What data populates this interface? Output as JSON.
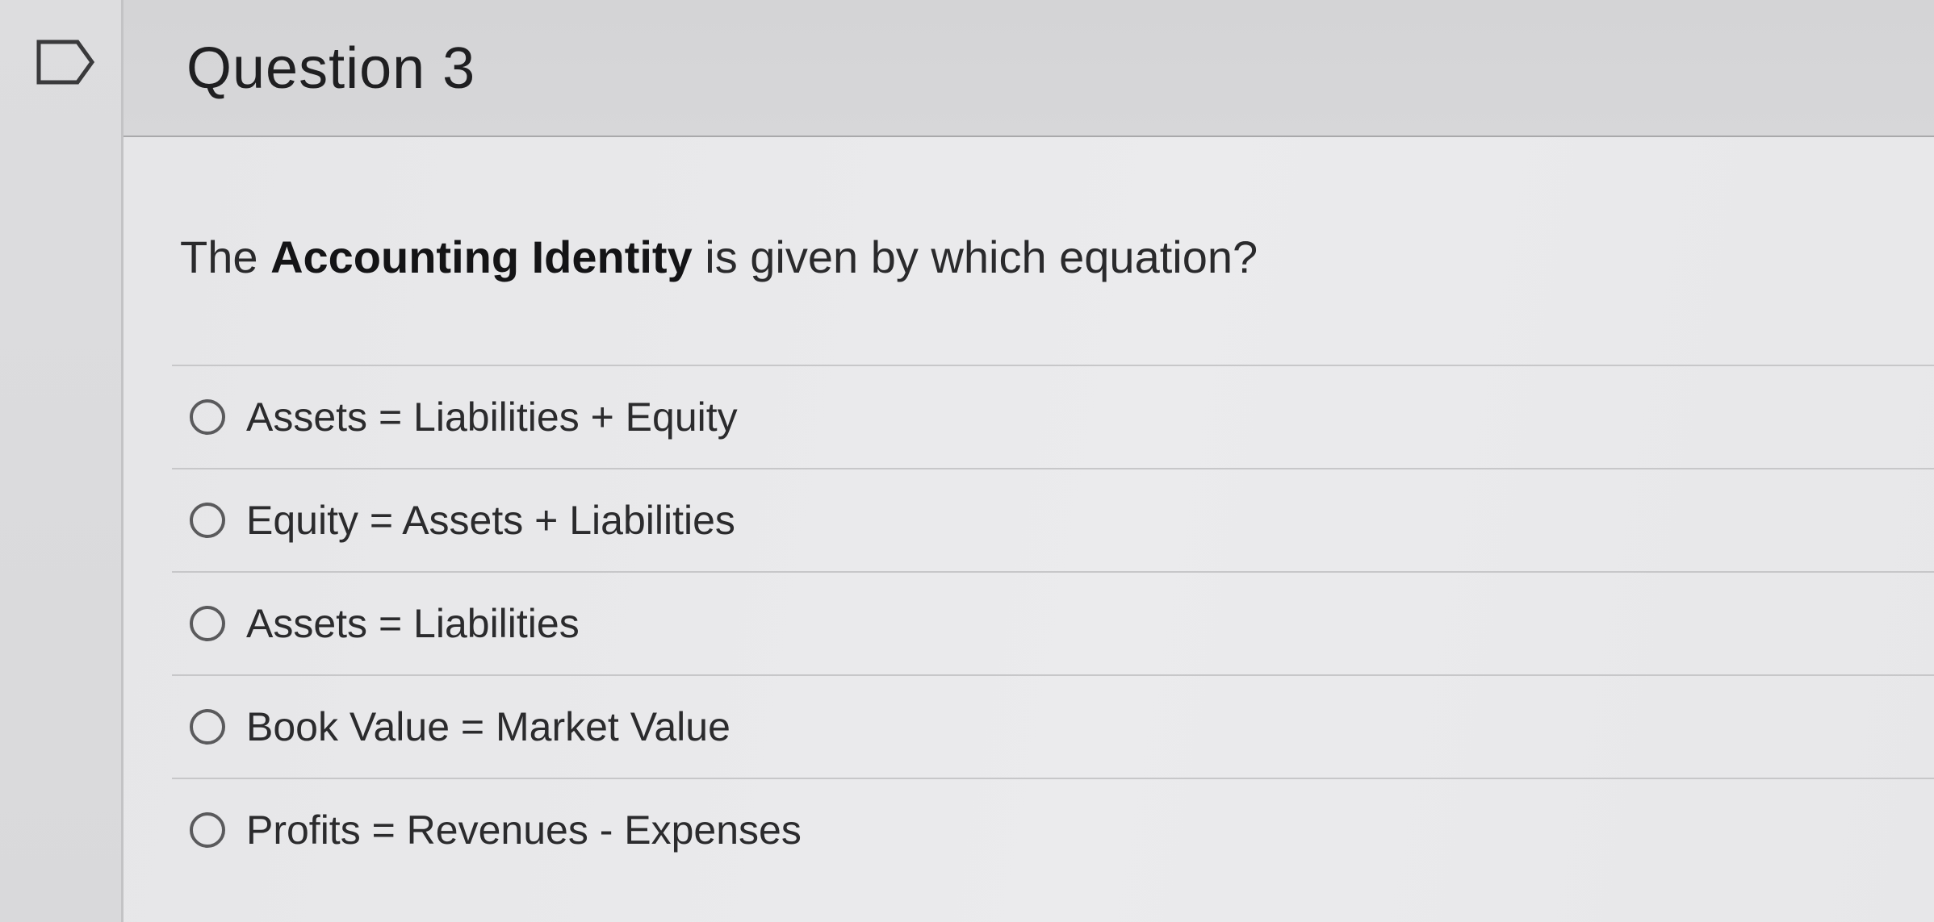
{
  "question": {
    "title": "Question 3",
    "prompt_pre": "The ",
    "prompt_bold": "Accounting Identity",
    "prompt_post": " is given by which equation?"
  },
  "options": [
    {
      "label": "Assets = Liabilities + Equity",
      "selected": false
    },
    {
      "label": "Equity = Assets + Liabilities",
      "selected": false
    },
    {
      "label": "Assets = Liabilities",
      "selected": false
    },
    {
      "label": "Book Value = Market Value",
      "selected": false
    },
    {
      "label": "Profits = Revenues - Expenses",
      "selected": false
    }
  ],
  "icons": {
    "flag": "flag-outline-icon",
    "radio": "radio-unselected-icon"
  },
  "colors": {
    "background": "#d9d9db",
    "body": "#e8e8ea",
    "text": "#2a2a2c"
  }
}
